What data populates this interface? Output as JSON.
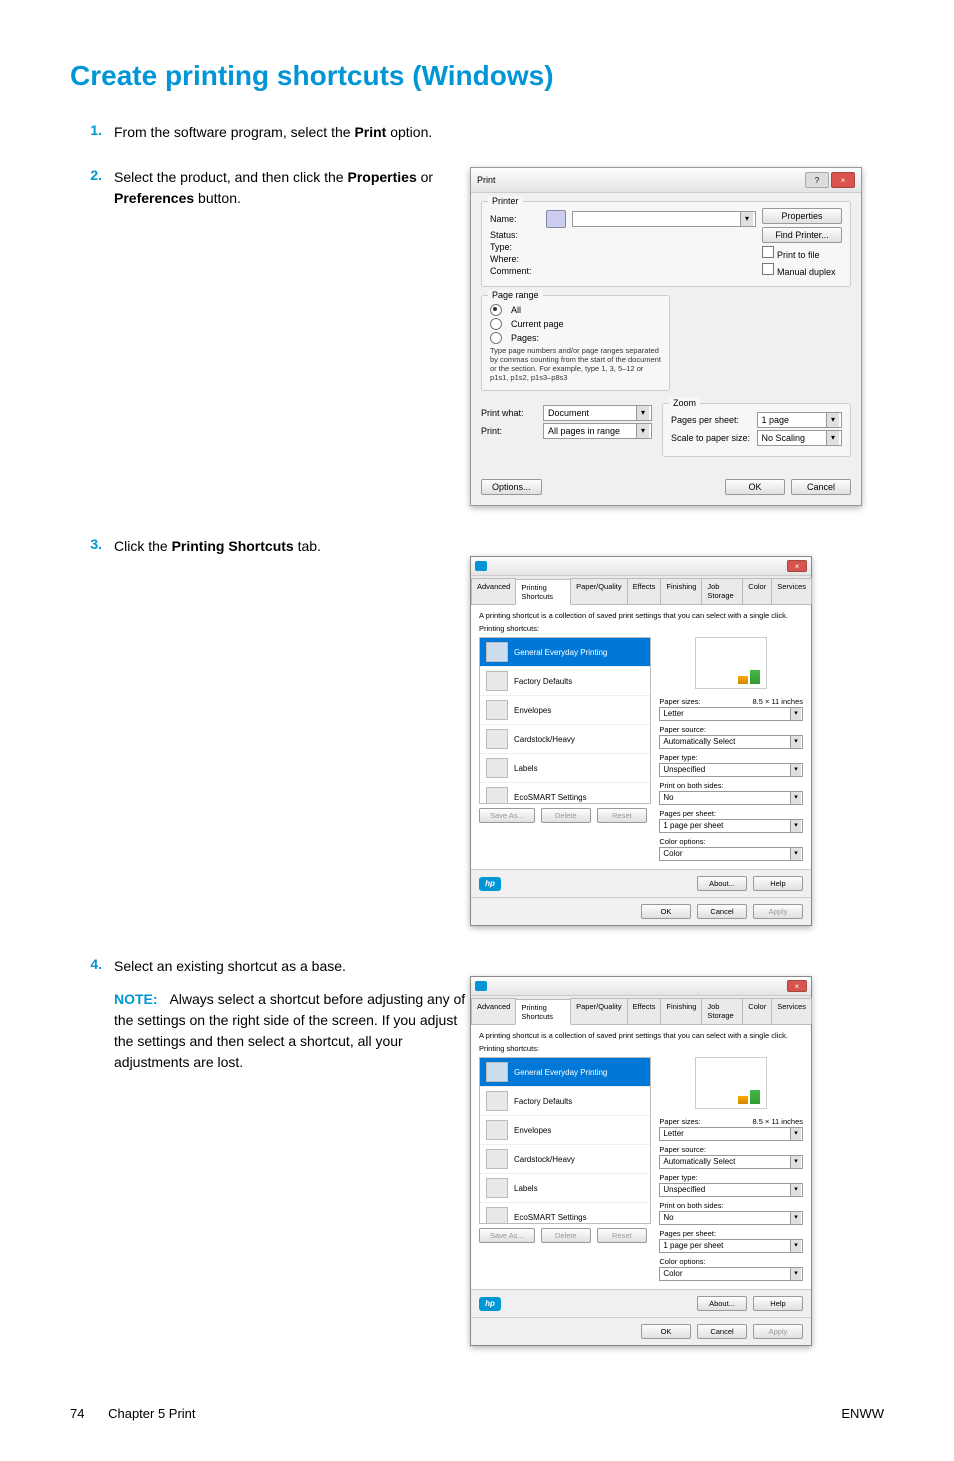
{
  "title": "Create printing shortcuts (Windows)",
  "steps": {
    "s1": {
      "num": "1.",
      "text_a": "From the software program, select the ",
      "bold": "Print",
      "text_b": " option."
    },
    "s2": {
      "num": "2.",
      "text_a": "Select the product, and then click the ",
      "bold1": "Properties",
      "mid": " or ",
      "bold2": "Preferences",
      "text_b": " button."
    },
    "s3": {
      "num": "3.",
      "text_a": "Click the ",
      "bold": "Printing Shortcuts",
      "text_b": " tab."
    },
    "s4": {
      "num": "4.",
      "text": "Select an existing shortcut as a base.",
      "note_label": "NOTE:",
      "note": "Always select a shortcut before adjusting any of the settings on the right side of the screen. If you adjust the settings and then select a shortcut, all your adjustments are lost."
    }
  },
  "print_dialog": {
    "title": "Print",
    "printer": {
      "legend": "Printer",
      "name": "Name:",
      "status": "Status:",
      "type": "Type:",
      "where": "Where:",
      "comment": "Comment:",
      "properties": "Properties",
      "find": "Find Printer...",
      "to_file": "Print to file",
      "duplex": "Manual duplex"
    },
    "page_range": {
      "legend": "Page range",
      "all": "All",
      "current": "Current page",
      "pages": "Pages:",
      "hint1": "Type page numbers and/or page ranges separated by commas counting from the start of the document or the section. For example, type 1, 3, 5–12 or p1s1, p1s2, p1s3–p8s3"
    },
    "zoom": {
      "legend": "Zoom",
      "pps": "Pages per sheet:",
      "pps_v": "1 page",
      "sps": "Scale to paper size:",
      "sps_v": "No Scaling"
    },
    "print_what": "Print what:",
    "print_what_v": "Document",
    "print": "Print:",
    "print_v": "All pages in range",
    "options": "Options...",
    "ok": "OK",
    "cancel": "Cancel"
  },
  "props": {
    "tabs": [
      "Advanced",
      "Printing Shortcuts",
      "Paper/Quality",
      "Effects",
      "Finishing",
      "Job Storage",
      "Color",
      "Services"
    ],
    "desc": "A printing shortcut is a collection of saved print settings that you can select with a single click.",
    "list_label": "Printing shortcuts:",
    "items": [
      "General Everyday Printing",
      "Factory Defaults",
      "Envelopes",
      "Cardstock/Heavy",
      "Labels",
      "EcoSMART Settings"
    ],
    "right": {
      "sizes": "Paper sizes:",
      "sizes_v": "Letter",
      "sizes_dim": "8.5 × 11 inches",
      "source": "Paper source:",
      "source_v": "Automatically Select",
      "type": "Paper type:",
      "type_v": "Unspecified",
      "both": "Print on both sides:",
      "both_v": "No",
      "pps": "Pages per sheet:",
      "pps_v": "1 page per sheet",
      "color": "Color options:",
      "color_v": "Color"
    },
    "save": "Save As...",
    "delete": "Delete",
    "reset": "Reset",
    "about": "About...",
    "help": "Help",
    "ok": "OK",
    "cancel": "Cancel",
    "apply": "Apply"
  },
  "footer": {
    "page": "74",
    "chapter": "Chapter 5   Print",
    "right": "ENWW"
  }
}
